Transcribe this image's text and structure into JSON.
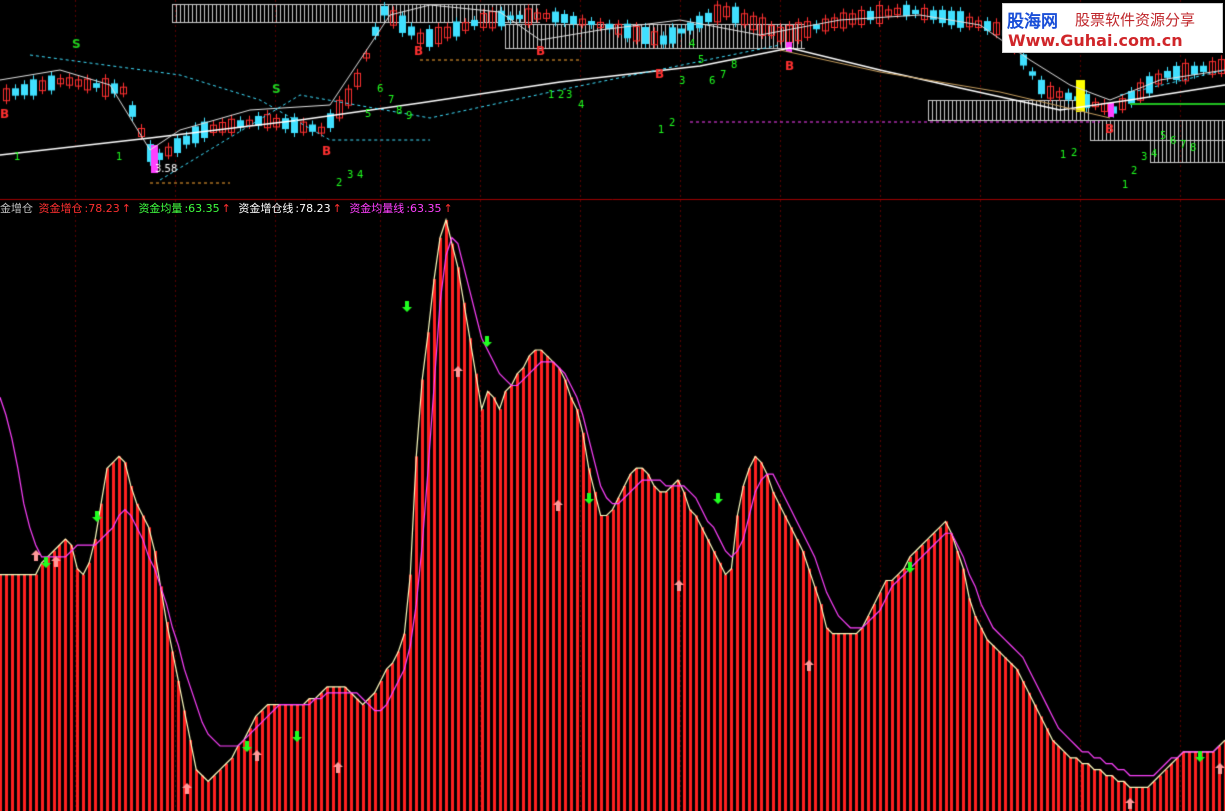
{
  "legend": {
    "indicator_name": "金增仓",
    "items": [
      {
        "label": "资金增仓",
        "value": "78.23",
        "color": "#ff3030"
      },
      {
        "label": "资金均量",
        "value": "63.35",
        "color": "#40ff40"
      },
      {
        "label": "资金增仓线",
        "value": "78.23",
        "color": "#ffffff"
      },
      {
        "label": "资金均量线",
        "value": "63.35",
        "color": "#ff40ff"
      }
    ],
    "arrow": "↑"
  },
  "watermark": {
    "brand": "股海网",
    "slogan": "股票软件资源分享",
    "url": "Www.Guhai.com.cn"
  },
  "colors": {
    "background": "#000000",
    "bar": "#ff2020",
    "up_candle": "#ff3030",
    "down_candle": "#40e0ff",
    "ma_line": "#ffffff",
    "avg_line": "#ff40ff",
    "signal_text": "#20ff20",
    "b_signal": "#ff3030",
    "dashed_grid": "#ff2020",
    "pane_separator": "#a00000"
  },
  "chart_data": [
    {
      "type": "line",
      "panel": "price",
      "series": [
        {
          "values": [
            60,
            58,
            57,
            56,
            55,
            54,
            53,
            52,
            51,
            50,
            49,
            48,
            47,
            46,
            45,
            44,
            43,
            42,
            41,
            40,
            38,
            36,
            34,
            32,
            30,
            28,
            26,
            24,
            23,
            22,
            21,
            20,
            19,
            18,
            17,
            16,
            15,
            14,
            13,
            12,
            11
          ]
        },
        {
          "values": [
            52,
            50,
            48,
            47,
            46,
            45,
            44,
            43,
            42,
            42,
            41,
            41,
            40,
            40,
            39,
            39,
            38,
            38,
            37,
            37,
            36,
            35,
            34,
            33,
            32,
            31,
            30,
            30,
            31,
            32,
            33,
            34,
            35,
            36,
            37,
            38,
            38,
            38,
            37,
            36,
            35
          ]
        }
      ],
      "annotations": {
        "price_label": "3.58",
        "sell_marker": "S",
        "buy_marker": "B",
        "counts": [
          "1",
          "2",
          "3",
          "4",
          "5",
          "6",
          "7",
          "8",
          "9"
        ]
      }
    },
    {
      "type": "bar",
      "panel": "indicator",
      "series": [
        {
          "name": "资金增仓",
          "values": [
            40,
            40,
            40,
            40,
            40,
            40,
            40,
            42,
            43,
            44,
            45,
            46,
            45,
            41,
            40,
            42,
            46,
            52,
            58,
            59,
            60,
            59,
            55,
            52,
            50,
            48,
            44,
            38,
            32,
            27,
            22,
            17,
            12,
            7,
            6,
            5,
            6,
            7,
            8,
            9,
            11,
            12,
            14,
            16,
            17,
            18,
            18,
            18,
            18,
            18,
            18,
            18,
            19,
            19,
            20,
            21,
            21,
            21,
            21,
            20,
            19,
            18,
            19,
            20,
            22,
            24,
            25,
            27,
            30,
            40,
            60,
            73,
            81,
            90,
            97,
            100,
            96,
            92,
            86,
            80,
            74,
            68,
            71,
            70,
            68,
            71,
            72,
            74,
            75,
            77,
            78,
            78,
            77,
            76,
            75,
            73,
            70,
            68,
            64,
            58,
            54,
            50,
            50,
            51,
            53,
            55,
            57,
            58,
            58,
            57,
            55,
            54,
            54,
            55,
            56,
            54,
            51,
            50,
            48,
            46,
            44,
            42,
            40,
            41,
            50,
            55,
            58,
            60,
            59,
            57,
            54,
            52,
            50,
            48,
            46,
            44,
            41,
            38,
            35,
            31,
            30,
            30,
            30,
            30,
            30,
            31,
            33,
            35,
            37,
            39,
            39,
            40,
            41,
            43,
            44,
            45,
            46,
            47,
            48,
            49,
            47,
            44,
            41,
            36,
            33,
            31,
            29,
            28,
            27,
            26,
            25,
            24,
            22,
            20,
            18,
            16,
            14,
            12,
            11,
            10,
            9,
            9,
            8,
            8,
            7,
            7,
            6,
            6,
            5,
            5,
            4,
            4,
            4,
            4,
            5,
            6,
            7,
            8,
            9,
            10,
            10,
            10,
            10,
            10,
            10,
            11,
            12
          ]
        },
        {
          "name": "资金均量",
          "values": [
            70,
            67,
            63,
            58,
            52,
            48,
            45,
            43,
            43,
            43,
            43,
            43,
            44,
            45,
            45,
            45,
            45,
            46,
            47,
            48,
            50,
            51,
            50,
            48,
            46,
            43,
            41,
            38,
            35,
            31,
            28,
            24,
            21,
            18,
            15,
            13,
            12,
            11,
            11,
            11,
            11,
            12,
            13,
            14,
            15,
            16,
            17,
            18,
            18,
            18,
            18,
            18,
            18,
            19,
            19,
            20,
            20,
            20,
            20,
            20,
            20,
            19,
            18,
            17,
            17,
            18,
            20,
            22,
            24,
            28,
            35,
            45,
            58,
            72,
            86,
            94,
            97,
            96,
            92,
            88,
            84,
            80,
            78,
            76,
            74,
            73,
            72,
            72,
            73,
            74,
            75,
            76,
            76,
            76,
            75,
            74,
            72,
            70,
            67,
            63,
            59,
            55,
            53,
            52,
            52,
            53,
            54,
            55,
            56,
            56,
            56,
            56,
            55,
            55,
            55,
            55,
            54,
            53,
            51,
            49,
            48,
            46,
            44,
            43,
            44,
            46,
            50,
            54,
            56,
            57,
            57,
            55,
            53,
            51,
            49,
            47,
            45,
            43,
            40,
            37,
            35,
            33,
            32,
            31,
            31,
            31,
            32,
            33,
            34,
            36,
            38,
            39,
            40,
            41,
            42,
            43,
            44,
            45,
            46,
            47,
            47,
            45,
            43,
            40,
            38,
            35,
            33,
            31,
            30,
            29,
            28,
            27,
            26,
            24,
            22,
            20,
            18,
            16,
            14,
            13,
            12,
            11,
            10,
            10,
            9,
            9,
            8,
            8,
            7,
            7,
            6,
            6,
            6,
            6,
            6,
            7,
            8,
            9,
            9,
            10,
            10,
            10,
            10,
            10,
            10,
            11
          ]
        }
      ],
      "signals": {
        "up_arrow_color": "#ff9999",
        "down_arrow_color": "#20ff20"
      }
    }
  ]
}
